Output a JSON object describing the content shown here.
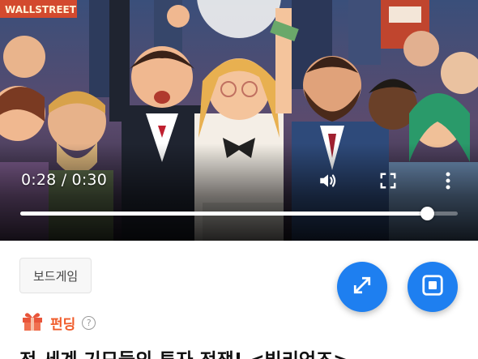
{
  "video": {
    "current_time": "0:28",
    "duration": "0:30",
    "time_display": "0:28 / 0:30",
    "progress": 0.93,
    "banner_text": "WALLSTREET",
    "icons": [
      "volume-icon",
      "fullscreen-icon",
      "more-vert-icon"
    ]
  },
  "product": {
    "category_chip": "보드게임",
    "status_label": "펀딩",
    "help_glyph": "?",
    "title": "전 세계 기묘들의 투자 전쟁! <빌리언즈>"
  },
  "fabs": {
    "expand_icon": "expand-arrows-icon",
    "stop_icon": "stop-square-icon"
  },
  "colors": {
    "accent_blue": "#1e7ff0",
    "funding_orange": "#f05b2a",
    "gift_red": "#e8553a"
  }
}
